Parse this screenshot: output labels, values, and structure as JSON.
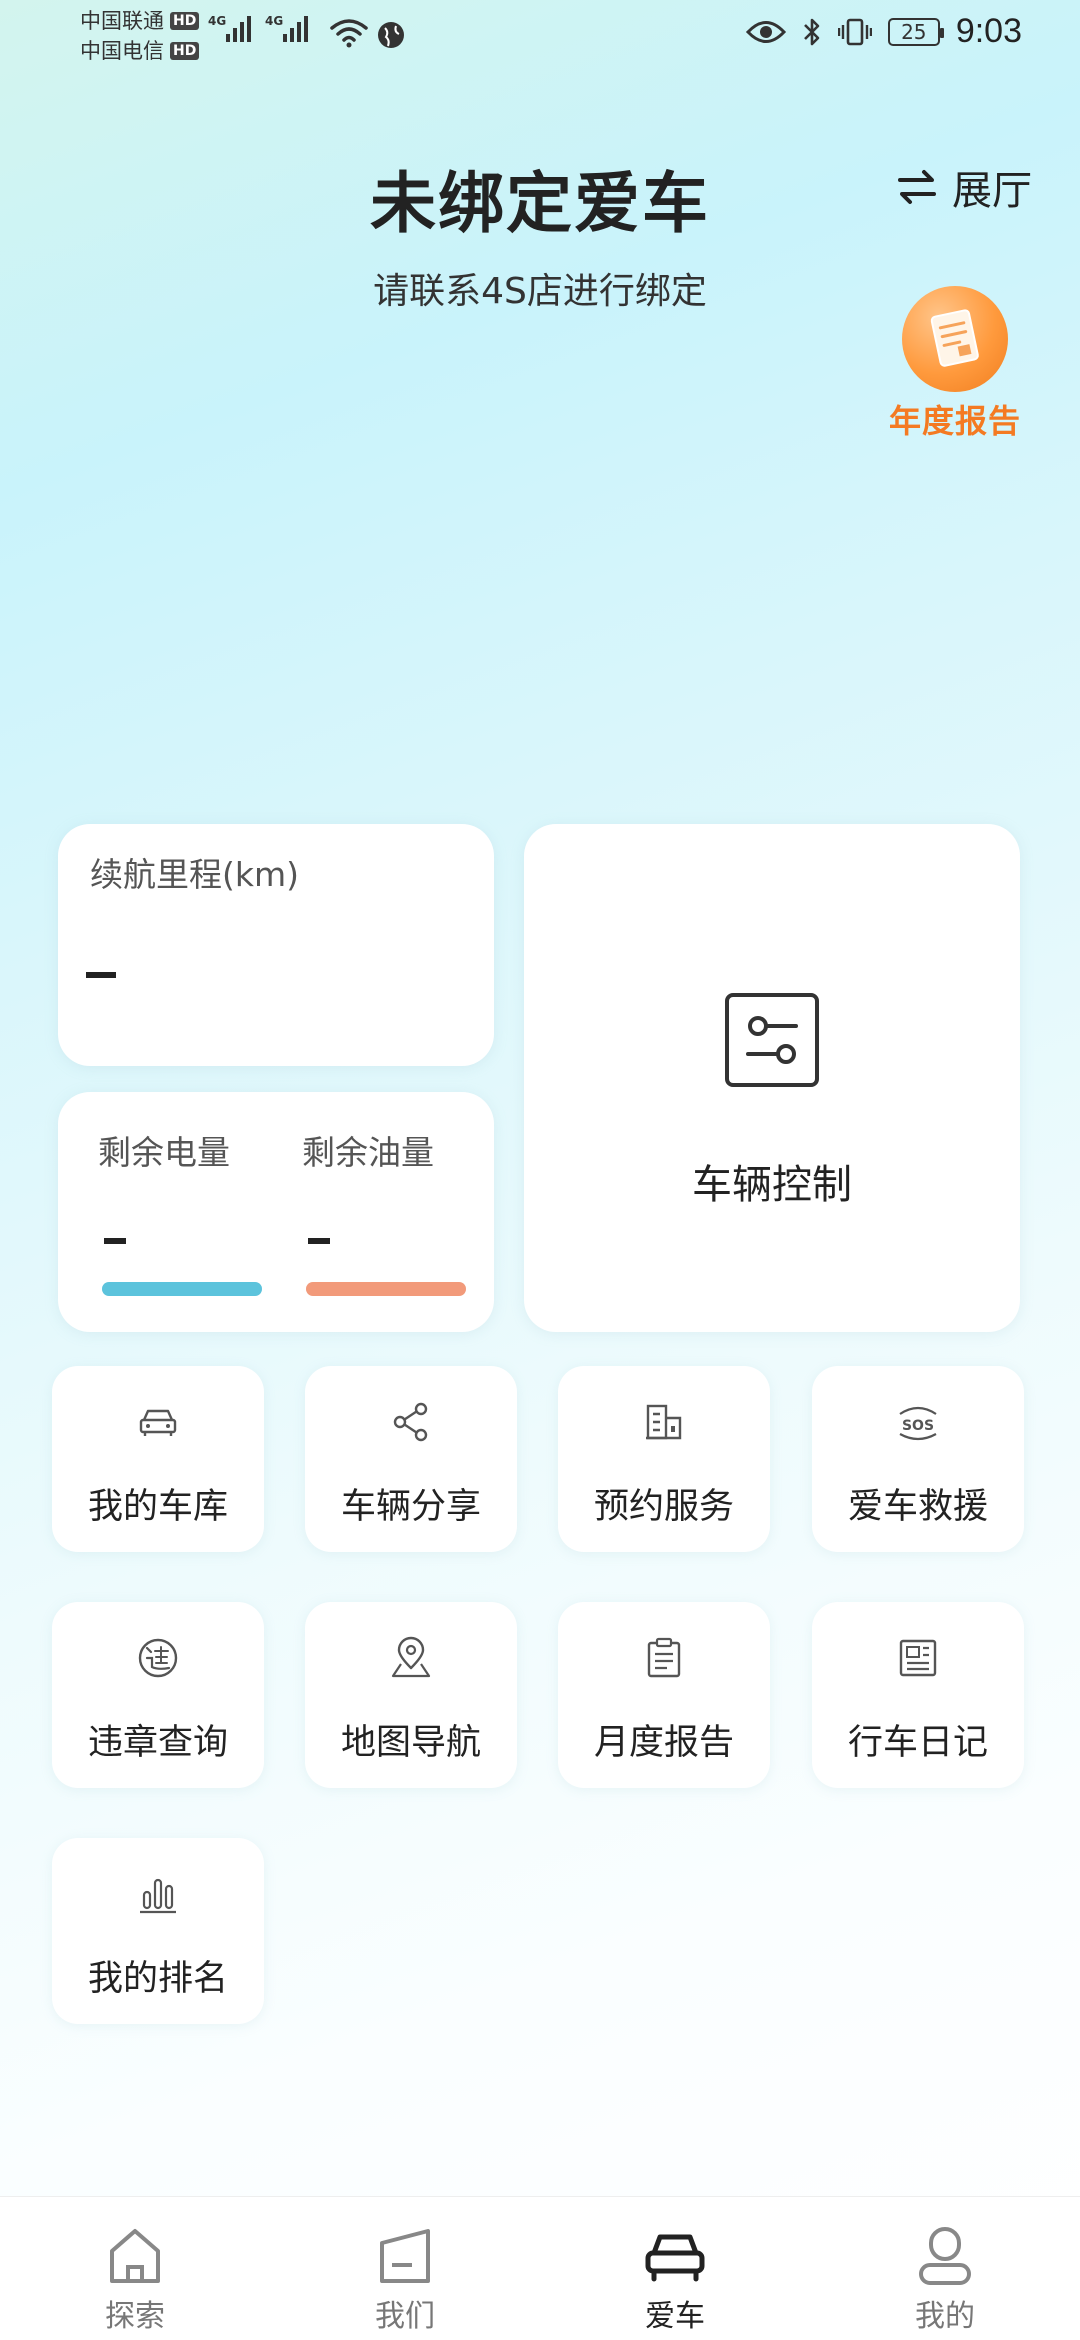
{
  "status_bar": {
    "carrier1": "中国联通",
    "carrier2": "中国电信",
    "hd": "HD",
    "net1": "4G",
    "net2": "4G",
    "battery": "25",
    "time": "9:03"
  },
  "header": {
    "title": "未绑定爱车",
    "subtitle": "请联系4S店进行绑定",
    "showroom_label": "展厅"
  },
  "annual_report": {
    "label": "年度报告"
  },
  "range_card": {
    "label": "续航里程(km)",
    "value": "-"
  },
  "energy_card": {
    "battery_label": "剩余电量",
    "battery_value": "-",
    "fuel_label": "剩余油量",
    "fuel_value": "-"
  },
  "control_card": {
    "label": "车辆控制"
  },
  "grid": {
    "items": [
      {
        "label": "我的车库",
        "icon": "car-icon"
      },
      {
        "label": "车辆分享",
        "icon": "share-icon"
      },
      {
        "label": "预约服务",
        "icon": "building-icon"
      },
      {
        "label": "爱车救援",
        "icon": "sos-icon"
      },
      {
        "label": "违章查询",
        "icon": "violation-icon"
      },
      {
        "label": "地图导航",
        "icon": "map-pin-icon"
      },
      {
        "label": "月度报告",
        "icon": "clipboard-icon"
      },
      {
        "label": "行车日记",
        "icon": "newspaper-icon"
      },
      {
        "label": "我的排名",
        "icon": "bar-chart-icon"
      }
    ]
  },
  "bottom_nav": {
    "items": [
      {
        "label": "探索",
        "icon": "home-icon"
      },
      {
        "label": "我们",
        "icon": "flag-icon"
      },
      {
        "label": "爱车",
        "icon": "car-icon"
      },
      {
        "label": "我的",
        "icon": "person-icon"
      }
    ],
    "active": "爱车"
  },
  "colors": {
    "battery_bar": "#5cc3dc",
    "fuel_bar": "#f29a7a",
    "annual_orange": "#f47a22"
  }
}
